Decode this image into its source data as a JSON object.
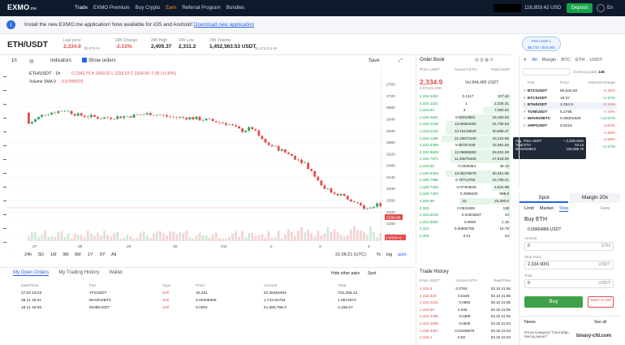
{
  "nav": {
    "logo": "EXMO",
    "logo_suffix": ".me",
    "menu": [
      "Trade",
      "EXMO Premium",
      "Buy Crypto",
      "Earn",
      "Referral Program",
      "Bundles"
    ],
    "balance": "116,859.42 USD",
    "deposit": "Deposit",
    "lang": "En"
  },
  "banner": {
    "text": "Install the new EXMO.me application! Now available for iOS and Android!",
    "link": "Download new application"
  },
  "pair": {
    "name": "ETH/USDT",
    "stats": [
      {
        "label": "Last price",
        "value": "2,334.9",
        "sub": "$2,378.01",
        "cls": "red"
      },
      {
        "label": "24h Change",
        "value": "-2.15%",
        "cls": "red"
      },
      {
        "label": "24h High",
        "value": "2,405.37"
      },
      {
        "label": "24h Low",
        "value": "2,311.2"
      },
      {
        "label": "24h Volume",
        "value": "1,452,563.53 USDT",
        "sub": "$1,478,114.46"
      }
    ]
  },
  "fee": {
    "label": "Fee Level",
    "level": "1",
    "vol": "$6,710 / $10,000"
  },
  "toolbar": {
    "interval": "1h",
    "indicators": "Indicators",
    "show_orders": "Show orders",
    "save": "Save"
  },
  "chart_header": {
    "symbol": "ETH/USDT · 1h",
    "ohlc": "O 2341.76  H 2343.01  L 2333.53  C 2334.90  -7.05 (-0.30%)",
    "vol": "Volume SMA 9",
    "vol_val": "6.97995976",
    "last_tag": "2334.90",
    "ask_tag": "2 975/9+/1"
  },
  "chart_data": {
    "type": "candlestick",
    "y_ticks": [
      2760,
      2720,
      2680,
      2640,
      2600,
      2560,
      2520,
      2480,
      2440,
      2400,
      2360,
      2320,
      2280,
      2240
    ],
    "x_ticks": [
      "27",
      "28",
      "29",
      "30",
      "Oct",
      "2",
      "3",
      "4"
    ],
    "ylim": [
      2220,
      2780
    ]
  },
  "timefoot": {
    "ranges": [
      "24h",
      "5D",
      "1M",
      "3M",
      "6M",
      "1Y",
      "5Y",
      "All"
    ],
    "clock": "21:06:21 (UTC)",
    "pct": "%",
    "log": "log",
    "auto": "auto"
  },
  "orders": {
    "tabs": [
      "My Open Orders",
      "My Trading History",
      "Wallet"
    ],
    "hide": "Hide other pairs",
    "filter": "Spot",
    "headers": [
      "Date/Time",
      "Pair",
      "Type",
      "Price",
      "Amount",
      "Total"
    ],
    "rows": [
      [
        "27.02 19:23",
        "YFI/USDT",
        "Sell",
        "32,251",
        "22.39484404",
        "722,258.13"
      ],
      [
        "08.11 18:31",
        "WAVES/BTC",
        "Sell",
        "0.00109385",
        "1,743.81794",
        "1.9072574"
      ],
      [
        "18.11 18:06",
        "SHIB/USDT",
        "Sell",
        "0.0001",
        "21,580,789.3",
        "2,158.57"
      ]
    ]
  },
  "orderbook": {
    "title": "Order Book",
    "cols": [
      "Price USDT",
      "Amount ETH",
      "Total USDT"
    ],
    "last": "2,334.9",
    "last_sub": "2,379.01 USD",
    "vol_label": "Vol",
    "vol": "844,485 USDT",
    "rows": [
      [
        "2,334.3301",
        "0.1317",
        "307.42",
        0.1
      ],
      [
        "2,334.1101",
        "1",
        "2,334.31",
        0.2
      ],
      [
        "2,333.64",
        "3",
        "7,000.92",
        0.3
      ],
      [
        "2,333.4641",
        "9.93412681",
        "23,180.92",
        0.55
      ],
      [
        "2,333.2158",
        "13.60953356",
        "31,755.53",
        0.7
      ],
      [
        "2,333.2120",
        "13.15126629",
        "30,685.27",
        0.7
      ],
      [
        "2,333.1198",
        "14.19673138",
        "33,122.56",
        0.75
      ],
      [
        "2,332.8358",
        "9.80767448",
        "22,881.55",
        0.55
      ],
      [
        "2,332.8829",
        "12.06655583",
        "28,204.39",
        0.65
      ],
      [
        "2,332.7971",
        "11.93875428",
        "27,818.99",
        0.65
      ],
      [
        "2,332.66",
        "0.0206354",
        "48.13",
        0.05
      ],
      [
        "2,330.6484",
        "13.05476675",
        "30,451.65",
        0.7
      ],
      [
        "2,329.7995",
        "9.75714758",
        "22,708.21",
        0.55
      ],
      [
        "2,329.7404",
        "2.07404536",
        "4,831.98",
        0.2
      ],
      [
        "2,329.7403",
        "0.2569425",
        "598.6",
        0.08
      ],
      [
        "2,329.98",
        "10",
        "23,290.8",
        0.55
      ],
      [
        "2,325",
        "0.0511828",
        "119",
        0.04
      ],
      [
        "2,323.2033",
        "0.01803837",
        "44",
        0.03
      ],
      [
        "2,321.0001",
        "0.0005",
        "1.15",
        0.02
      ],
      [
        "2,312",
        "0.00682758",
        "15.79",
        0.02
      ],
      [
        "2,305",
        "0.01",
        "23",
        0.02
      ]
    ]
  },
  "tooltip": {
    "l1": "Avg. Price USDT",
    "v1": "~ 2,333.0292",
    "l2": "Total ETH",
    "v2": "54.13",
    "l3": "55.02333612",
    "v3": "128,386.75"
  },
  "history": {
    "title": "Trade History",
    "cols": [
      "Price USDT",
      "Amount ETH",
      "Date/Time"
    ],
    "rows": [
      [
        "2,334.9",
        "0.0783",
        "03.10 21:06"
      ],
      [
        "2,333.325",
        "0.0329",
        "03.10 21:05"
      ],
      [
        "2,333.3101",
        "0.0883",
        "03.10 21:05"
      ],
      [
        "2,333.68",
        "0.046",
        "03.10 21:05"
      ],
      [
        "2,334.4395",
        "0.0369",
        "03.10 21:05"
      ],
      [
        "2,334.4935",
        "0.0835",
        "03.10 21:04"
      ],
      [
        "2,335.3467",
        "0.01535976",
        "03.10 21:04"
      ],
      [
        "2,336.1",
        "0.03",
        "03.10 21:04"
      ]
    ]
  },
  "markets": {
    "tabs": [
      "All",
      "Margin",
      "BTC",
      "ETH",
      "USDT"
    ],
    "currency_pairs": "Currency pairs",
    "count": "145",
    "cols": [
      "Pair",
      "Price",
      "Volume/Change"
    ],
    "rows": [
      [
        "BTC/USDT",
        "60,644.82",
        "-0.46%",
        "red"
      ],
      [
        "ETC/USDT",
        "18.37",
        "+1.37%",
        "green"
      ],
      [
        "ETH/USDT",
        "2,334.9",
        "-2.15%",
        "red"
      ],
      [
        "TON/USDT",
        "5.2785",
        "-7.49%",
        "red"
      ],
      [
        "WAVES/BTC",
        "0.00001925",
        "+12.57%",
        "green"
      ],
      [
        "XRP/USDT",
        "0.5218",
        "-4.63%",
        "red"
      ],
      [
        "",
        "",
        "-1.98%",
        "red"
      ],
      [
        "",
        "",
        "-1.68%",
        "red"
      ],
      [
        "",
        "",
        "+4.37%",
        "green"
      ]
    ]
  },
  "trade": {
    "spot": "Spot",
    "margin": "Margin 20x",
    "types": [
      "Limit",
      "Market",
      "Stop"
    ],
    "fees": "Fees",
    "buy": "Buy ETH",
    "avail": "0.00664866 USDT",
    "amount_label": "Amount",
    "amount": "0",
    "amount_unit": "ETH",
    "stop_label": "Stop Price",
    "stop": "2,334.9001",
    "stop_unit": "USDT",
    "total_label": "Total",
    "total": "0",
    "total_unit": "USDT",
    "buy_btn": "Buy",
    "sell_btn": "Switch to Sell"
  },
  "news": {
    "title": "News",
    "see_all": "See all",
    "item": "Итоги конкурса \"Сентябрь. Месяц монет\"",
    "brand": "binary-cfd.com"
  }
}
